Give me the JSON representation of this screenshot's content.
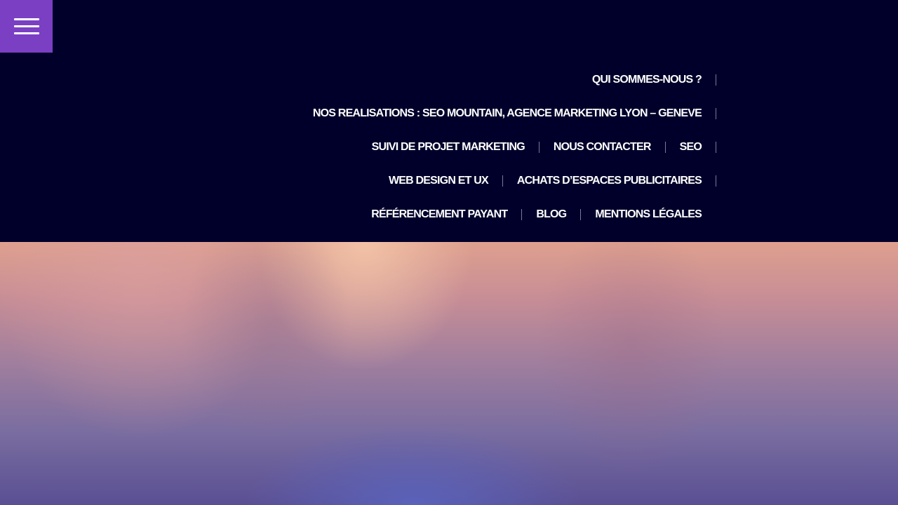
{
  "menu_toggle": {
    "icon": "hamburger-menu-icon",
    "color": "#7b3fc4"
  },
  "nav": {
    "background": "#00002b",
    "rows": [
      {
        "items": [
          {
            "label": "QUI SOMMES-NOUS ?",
            "slug": "qui-sommes-nous"
          }
        ],
        "trailing_separator": true
      },
      {
        "items": [
          {
            "label": "NOS REALISATIONS : SEO MOUNTAIN, AGENCE MARKETING LYON – GENEVE",
            "slug": "nos-realisations"
          }
        ],
        "trailing_separator": true
      },
      {
        "items": [
          {
            "label": "SUIVI DE PROJET MARKETING",
            "slug": "suivi-de-projet-marketing"
          },
          {
            "label": "NOUS CONTACTER",
            "slug": "nous-contacter"
          },
          {
            "label": "SEO",
            "slug": "seo"
          }
        ],
        "trailing_separator": true
      },
      {
        "items": [
          {
            "label": "WEB DESIGN ET UX",
            "slug": "web-design-et-ux"
          },
          {
            "label": "ACHATS D’ESPACES PUBLICITAIRES",
            "slug": "achats-espaces-publicitaires"
          }
        ],
        "trailing_separator": true
      },
      {
        "items": [
          {
            "label": "RÉFÉRENCEMENT PAYANT",
            "slug": "referencement-payant"
          },
          {
            "label": "BLOG",
            "slug": "blog"
          },
          {
            "label": "MENTIONS LÉGALES",
            "slug": "mentions-legales"
          }
        ],
        "trailing_separator": false
      }
    ]
  }
}
